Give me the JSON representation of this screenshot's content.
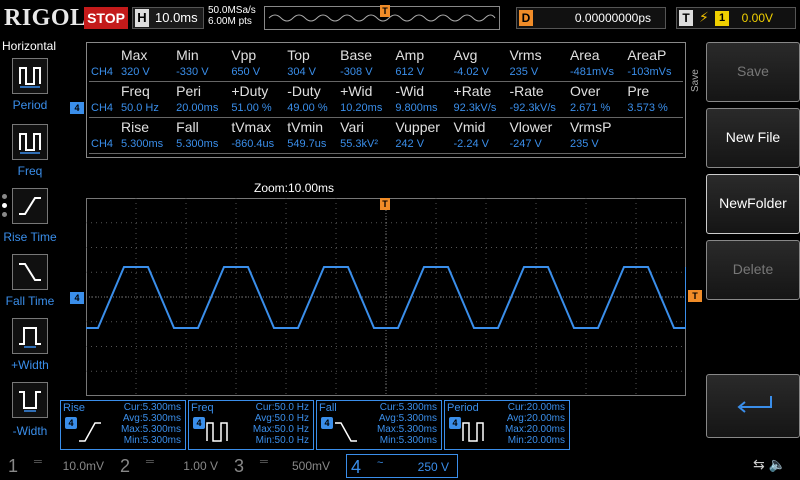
{
  "brand": "RIGOL",
  "run_state": "STOP",
  "timebase": {
    "label": "H",
    "value": "10.0ms"
  },
  "sampling": {
    "rate": "50.0MSa/s",
    "points": "6.00M pts"
  },
  "trigger_pos_label": "T",
  "delay": {
    "label": "D",
    "value": "0.00000000ps"
  },
  "trigger": {
    "label": "T",
    "edge": "⚡",
    "source": "1",
    "level": "0.00V"
  },
  "left_panel": {
    "title": "Horizontal",
    "items": [
      {
        "label": "Period"
      },
      {
        "label": "Freq"
      },
      {
        "label": "Rise Time"
      },
      {
        "label": "Fall Time"
      },
      {
        "label": "+Width"
      },
      {
        "label": "-Width"
      }
    ]
  },
  "measure_table": {
    "rows": [
      {
        "headers": [
          "",
          "Max",
          "Min",
          "Vpp",
          "Top",
          "Base",
          "Amp",
          "Avg",
          "Vrms",
          "Area",
          "AreaP"
        ],
        "values": [
          "CH4",
          "320 V",
          "-330 V",
          "650 V",
          "304 V",
          "-308 V",
          "612 V",
          "-4.02 V",
          "235 V",
          "-481mVs",
          "-103mVs"
        ]
      },
      {
        "headers": [
          "",
          "Freq",
          "Peri",
          "+Duty",
          "-Duty",
          "+Wid",
          "-Wid",
          "+Rate",
          "-Rate",
          "Over",
          "Pre"
        ],
        "values": [
          "CH4",
          "50.0 Hz",
          "20.00ms",
          "51.00 %",
          "49.00 %",
          "10.20ms",
          "9.800ms",
          "92.3kV/s",
          "-92.3kV/s",
          "2.671 %",
          "3.573 %"
        ]
      },
      {
        "headers": [
          "",
          "Rise",
          "Fall",
          "tVmax",
          "tVmin",
          "Vari",
          "Vupper",
          "Vmid",
          "Vlower",
          "VrmsP",
          ""
        ],
        "values": [
          "CH4",
          "5.300ms",
          "5.300ms",
          "-860.4us",
          "549.7us",
          "55.3kV²",
          "242 V",
          "-2.24 V",
          "-247 V",
          "235 V",
          ""
        ]
      }
    ]
  },
  "zoom_label": "Zoom:10.00ms",
  "channel_marker": "4",
  "save_tab": "Save",
  "stat_boxes": [
    {
      "name": "Rise",
      "ch": "4",
      "cur": "Cur:5.300ms",
      "avg": "Avg:5.300ms",
      "max": "Max:5.300ms",
      "min": "Min:5.300ms"
    },
    {
      "name": "Freq",
      "ch": "4",
      "cur": "Cur:50.0 Hz",
      "avg": "Avg:50.0 Hz",
      "max": "Max:50.0 Hz",
      "min": "Min:50.0 Hz"
    },
    {
      "name": "Fall",
      "ch": "4",
      "cur": "Cur:5.300ms",
      "avg": "Avg:5.300ms",
      "max": "Max:5.300ms",
      "min": "Min:5.300ms"
    },
    {
      "name": "Period",
      "ch": "4",
      "cur": "Cur:20.00ms",
      "avg": "Avg:20.00ms",
      "max": "Max:20.00ms",
      "min": "Min:20.00ms"
    }
  ],
  "right_menu": {
    "save": "Save",
    "new_file": "New File",
    "new_folder": "NewFolder",
    "delete": "Delete"
  },
  "channels": [
    {
      "num": "1",
      "coupling": "═",
      "scale": "10.0mV"
    },
    {
      "num": "2",
      "coupling": "═",
      "scale": "1.00 V"
    },
    {
      "num": "3",
      "coupling": "═",
      "scale": "500mV"
    },
    {
      "num": "4",
      "coupling": "~",
      "scale": "250 V"
    }
  ],
  "status_icons": "⇆ 🔈",
  "colors": {
    "ch4": "#3a8eea",
    "trigger": "#f08c28",
    "stop": "#c41a1a",
    "trigger_level": "#f0d000"
  }
}
